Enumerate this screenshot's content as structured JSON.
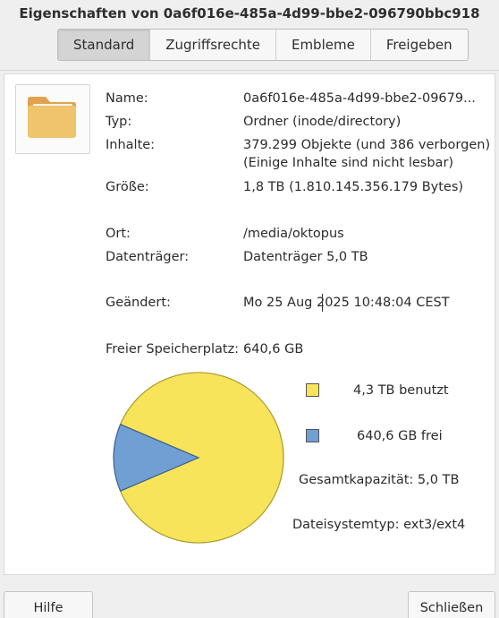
{
  "window": {
    "title": "Eigenschaften von 0a6f016e-485a-4d99-bbe2-096790bbc918"
  },
  "tabs": [
    {
      "label": "Standard",
      "active": true
    },
    {
      "label": "Zugriffsrechte",
      "active": false
    },
    {
      "label": "Embleme",
      "active": false
    },
    {
      "label": "Freigeben",
      "active": false
    }
  ],
  "icon": {
    "name": "folder-icon",
    "color": "#f0c36d"
  },
  "properties": {
    "name_label": "Name:",
    "name_value": "0a6f016e-485a-4d99-bbe2-09679...",
    "type_label": "Typ:",
    "type_value": "Ordner (inode/directory)",
    "contents_label": "Inhalte:",
    "contents_value_line1": "379.299 Objekte (und 386 verborgen)",
    "contents_value_line2": "(Einige Inhalte sind nicht lesbar)",
    "size_label": "Größe:",
    "size_value": "1,8 TB (1.810.145.356.179 Bytes)",
    "location_label": "Ort:",
    "location_value": "/media/oktopus",
    "volume_label": "Datenträger:",
    "volume_value": "Datenträger 5,0 TB",
    "modified_label": "Geändert:",
    "modified_value": "Mo 25 Aug 2025 10:48:04 CEST",
    "free_space_label": "Freier Speicherplatz:",
    "free_space_value": "640,6 GB"
  },
  "usage": {
    "used_label": "4,3 TB benutzt",
    "free_label": "640,6 GB frei",
    "used_color": "#f8e45a",
    "free_color": "#6f9fd3",
    "used_fraction": 0.872,
    "free_fraction": 0.128,
    "capacity_text": "Gesamtkapazität: 5,0 TB",
    "filesystem_text": "Dateisystemtyp: ext3/ext4"
  },
  "buttons": {
    "help": "Hilfe",
    "close": "Schließen"
  }
}
